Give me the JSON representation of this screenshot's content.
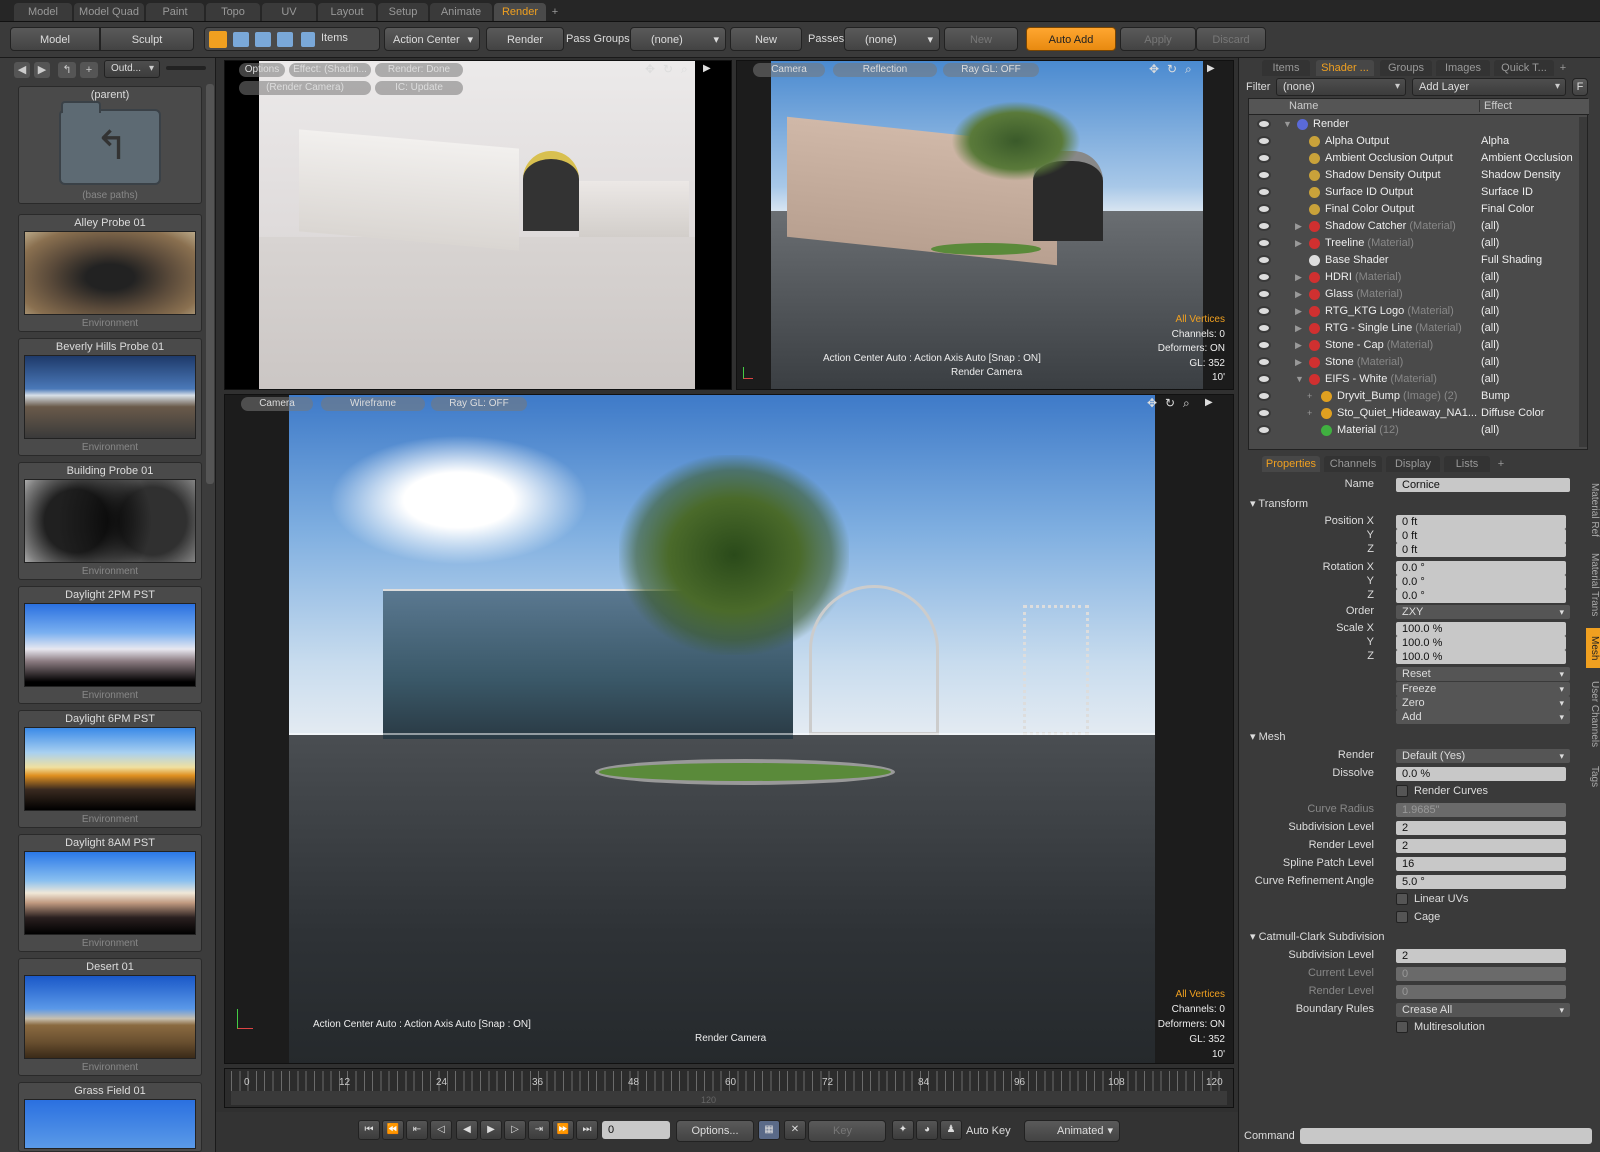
{
  "mode_tabs": [
    "Model",
    "Model Quad",
    "Paint",
    "Topo",
    "UV",
    "Layout",
    "Setup",
    "Animate",
    "Render",
    "+"
  ],
  "toolbar": {
    "model": "Model",
    "sculpt": "Sculpt",
    "items": "Items",
    "action_center": "Action Center",
    "render": "Render",
    "pass_groups_label": "Pass Groups",
    "pass_groups_value": "(none)",
    "new": "New",
    "passes_label": "Passes",
    "passes_value": "(none)",
    "new2": "New",
    "auto_add": "Auto Add",
    "apply": "Apply",
    "discard": "Discard"
  },
  "left_panel": {
    "dropdown": "Outd...",
    "parent": {
      "title": "(parent)",
      "subtitle": "(base paths)"
    },
    "presets": [
      {
        "title": "Alley Probe 01",
        "type": "Environment"
      },
      {
        "title": "Beverly Hills Probe 01",
        "type": "Environment"
      },
      {
        "title": "Building Probe 01",
        "type": "Environment"
      },
      {
        "title": "Daylight 2PM PST",
        "type": "Environment"
      },
      {
        "title": "Daylight 6PM PST",
        "type": "Environment"
      },
      {
        "title": "Daylight 8AM PST",
        "type": "Environment"
      },
      {
        "title": "Desert 01",
        "type": "Environment"
      },
      {
        "title": "Grass Field 01",
        "type": ""
      }
    ]
  },
  "viewport_tl": {
    "options": "Options",
    "effect": "Effect: (Shadin...",
    "render_done": "Render: Done",
    "render_camera": "(Render Camera)",
    "ic_update": "IC: Update"
  },
  "viewport_tr": {
    "camera": "Camera",
    "reflection": "Reflection",
    "raygl": "Ray GL: OFF",
    "all_vertices": "All Vertices",
    "channels": "Channels: 0",
    "deformers": "Deformers: ON",
    "gl": "GL: 352",
    "dist": "10'",
    "action": "Action Center Auto : Action Axis Auto  [Snap : ON]",
    "cam": "Render Camera"
  },
  "viewport_main": {
    "camera": "Camera",
    "wireframe": "Wireframe",
    "raygl": "Ray GL: OFF",
    "all_vertices": "All Vertices",
    "channels": "Channels: 0",
    "deformers": "Deformers: ON",
    "gl": "GL: 352",
    "dist": "10'",
    "action": "Action Center Auto : Action Axis Auto  [Snap : ON]",
    "cam": "Render Camera"
  },
  "timeline": {
    "ticks": [
      "0",
      "12",
      "24",
      "36",
      "48",
      "60",
      "72",
      "84",
      "96",
      "108",
      "120"
    ],
    "end": "120",
    "frame": "0",
    "options": "Options...",
    "key": "Key",
    "auto_key": "Auto Key",
    "animated": "Animated"
  },
  "shader": {
    "tabs": [
      "Items",
      "Shader ...",
      "Groups",
      "Images",
      "Quick T...",
      "+"
    ],
    "filter_label": "Filter",
    "filter_value": "(none)",
    "add_layer": "Add Layer",
    "f": "F",
    "col_name": "Name",
    "col_effect": "Effect",
    "rows": [
      {
        "name": "Render",
        "sub": "",
        "effect": "",
        "indent": 0,
        "color": "#5a6ad8"
      },
      {
        "name": "Alpha Output",
        "sub": "",
        "effect": "Alpha",
        "indent": 1,
        "color": "#c9a23a"
      },
      {
        "name": "Ambient Occlusion Output",
        "sub": "",
        "effect": "Ambient Occlusion",
        "indent": 1,
        "color": "#c9a23a"
      },
      {
        "name": "Shadow Density Output",
        "sub": "",
        "effect": "Shadow Density",
        "indent": 1,
        "color": "#c9a23a"
      },
      {
        "name": "Surface ID Output",
        "sub": "",
        "effect": "Surface ID",
        "indent": 1,
        "color": "#c9a23a"
      },
      {
        "name": "Final Color Output",
        "sub": "",
        "effect": "Final Color",
        "indent": 1,
        "color": "#c9a23a"
      },
      {
        "name": "Shadow Catcher",
        "sub": "(Material)",
        "effect": "(all)",
        "indent": 1,
        "color": "#d03030"
      },
      {
        "name": "Treeline",
        "sub": "(Material)",
        "effect": "(all)",
        "indent": 1,
        "color": "#d03030"
      },
      {
        "name": "Base Shader",
        "sub": "",
        "effect": "Full Shading",
        "indent": 1,
        "color": "#dddddd"
      },
      {
        "name": "HDRI",
        "sub": "(Material)",
        "effect": "(all)",
        "indent": 1,
        "color": "#d03030"
      },
      {
        "name": "Glass",
        "sub": "(Material)",
        "effect": "(all)",
        "indent": 1,
        "color": "#d03030"
      },
      {
        "name": "RTG_KTG Logo",
        "sub": "(Material)",
        "effect": "(all)",
        "indent": 1,
        "color": "#d03030"
      },
      {
        "name": "RTG - Single Line",
        "sub": "(Material)",
        "effect": "(all)",
        "indent": 1,
        "color": "#d03030"
      },
      {
        "name": "Stone - Cap",
        "sub": "(Material)",
        "effect": "(all)",
        "indent": 1,
        "color": "#d03030"
      },
      {
        "name": "Stone",
        "sub": "(Material)",
        "effect": "(all)",
        "indent": 1,
        "color": "#d03030"
      },
      {
        "name": "EIFS - White",
        "sub": "(Material)",
        "effect": "(all)",
        "indent": 1,
        "color": "#d03030"
      },
      {
        "name": "Dryvit_Bump",
        "sub": "(Image) (2)",
        "effect": "Bump",
        "indent": 2,
        "color": "#e0a020"
      },
      {
        "name": "Sto_Quiet_Hideaway_NA1...",
        "sub": "",
        "effect": "Diffuse Color",
        "indent": 2,
        "color": "#e0a020"
      },
      {
        "name": "Material",
        "sub": "(12)",
        "effect": "(all)",
        "indent": 2,
        "color": "#40b040"
      }
    ]
  },
  "properties": {
    "tabs": [
      "Properties",
      "Channels",
      "Display",
      "Lists",
      "+"
    ],
    "name_label": "Name",
    "name_value": "Cornice",
    "transform": "Transform",
    "pos_x_label": "Position X",
    "y": "Y",
    "z": "Z",
    "pos_x": "0 ft",
    "pos_y": "0 ft",
    "pos_z": "0 ft",
    "rot_x_label": "Rotation X",
    "rot_x": "0.0 °",
    "rot_y": "0.0 °",
    "rot_z": "0.0 °",
    "order_label": "Order",
    "order": "ZXY",
    "scale_x_label": "Scale X",
    "scale_x": "100.0 %",
    "scale_y": "100.0 %",
    "scale_z": "100.0 %",
    "reset": "Reset",
    "freeze": "Freeze",
    "zero": "Zero",
    "add": "Add",
    "mesh": "Mesh",
    "render_label": "Render",
    "render_value": "Default (Yes)",
    "dissolve_label": "Dissolve",
    "dissolve": "0.0 %",
    "render_curves": "Render Curves",
    "curve_radius_label": "Curve Radius",
    "curve_radius": "1.9685\"",
    "subdiv_label": "Subdivision Level",
    "subdiv": "2",
    "render_level_label": "Render Level",
    "render_level": "2",
    "spline_label": "Spline Patch Level",
    "spline": "16",
    "curve_ref_label": "Curve Refinement Angle",
    "curve_ref": "5.0 °",
    "linear_uvs": "Linear UVs",
    "cage": "Cage",
    "catmull": "Catmull-Clark Subdivision",
    "cc_subdiv_label": "Subdivision Level",
    "cc_subdiv": "2",
    "current_level_label": "Current Level",
    "current_level": "0",
    "cc_render_level_label": "Render Level",
    "cc_render_level": "0",
    "boundary_label": "Boundary Rules",
    "boundary": "Crease All",
    "multires": "Multiresolution",
    "side_tabs": [
      "Material Ref",
      "Material Trans",
      "Mesh",
      "User Channels",
      "Tags"
    ]
  },
  "command_label": "Command"
}
